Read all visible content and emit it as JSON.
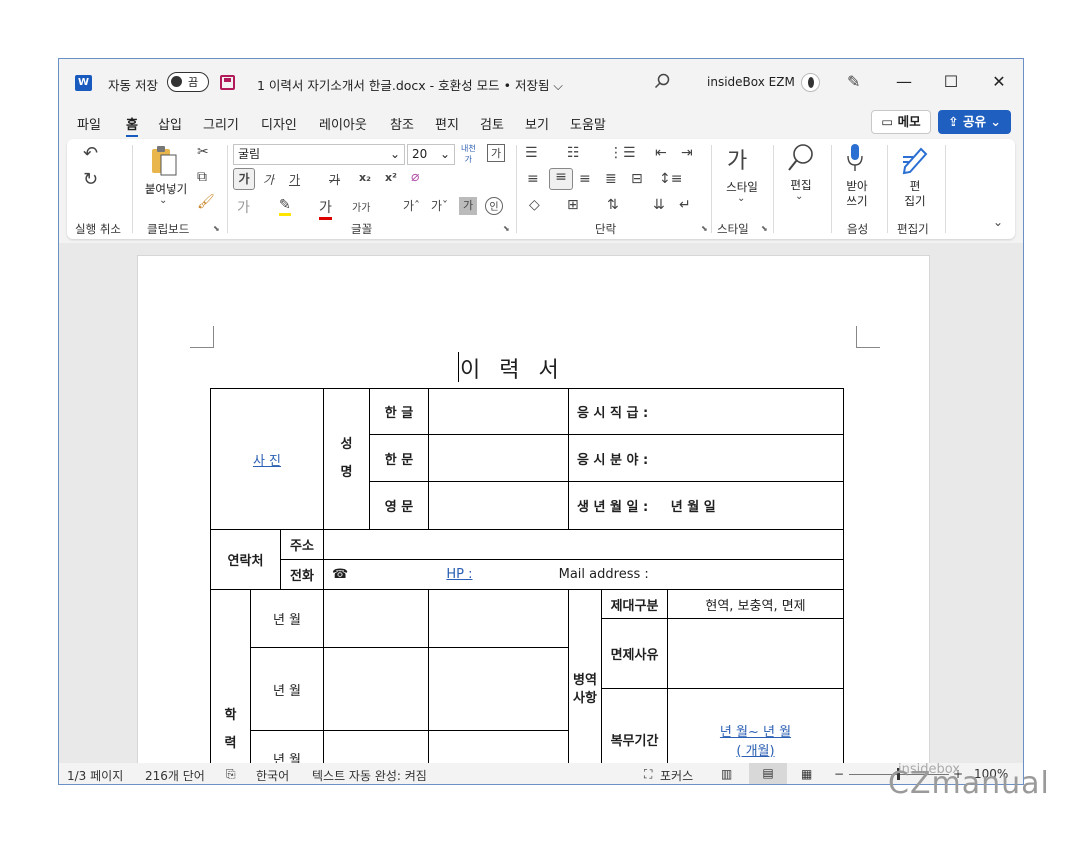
{
  "titlebar": {
    "app_icon": "W",
    "autosave_label": "자동 저장",
    "toggle_label": "끔",
    "document_title": "1 이력서   자기소개서 한글.docx  -  호환성 모드 • 저장됨 ⌵",
    "account_name": "insideBox EZM",
    "minimize": "—",
    "maximize": "☐",
    "close": "✕"
  },
  "menu": {
    "items": [
      "파일",
      "홈",
      "삽입",
      "그리기",
      "디자인",
      "레이아웃",
      "참조",
      "편지",
      "검토",
      "보기",
      "도움말"
    ],
    "memo_label": "메모",
    "share_label": "공유"
  },
  "ribbon": {
    "groups": {
      "undo": "실행 취소",
      "clipboard": "클립보드",
      "font": "글꼴",
      "paragraph": "단락",
      "styles": "스타일",
      "voice": "음성",
      "editor": "편집기"
    },
    "paste_label": "붙여넣기",
    "font_name": "굴림",
    "font_size": "20",
    "styles_label": "스타일",
    "edit_label": "편집",
    "dictate_label": "받아\n쓰기",
    "dictate_line1": "받아",
    "dictate_line2": "쓰기",
    "editor_line1": "편",
    "editor_line2": "집기",
    "bold_btn": "가",
    "italic_btn": "가",
    "underline_btn": "가",
    "strike_btn": "가",
    "sub_btn": "x₂",
    "sup_btn": "x²",
    "grow_btn": "가ˆ",
    "shrink_btn": "가ˇ",
    "case_btn": "가가",
    "highlight_btn": "가"
  },
  "document": {
    "title": "이   력   서",
    "photo_label": "사 진",
    "name_label": "성\n\n명",
    "name_label_1": "성",
    "name_label_2": "명",
    "hangul_label": "한 글",
    "hanja_label": "한 문",
    "english_label": "영 문",
    "position_label": "응 시 직 급 :",
    "field_label": "응 시 분 야 :",
    "birth_label": "생 년 월 일 :",
    "birth_format": "년    월    일",
    "contact_label": "연락처",
    "address_label": "주소",
    "phone_label": "전화",
    "phone_icon": "☎",
    "hp_label": "HP :",
    "mail_label": "Mail address :",
    "edu_label_1": "학",
    "edu_label_2": "력",
    "edu_rows": [
      "년   월",
      "년   월",
      "년   월"
    ],
    "military_label": "병역\n사항",
    "military_label_1": "병역",
    "military_label_2": "사항",
    "discharge_type_label": "제대구분",
    "discharge_type_value": "현역, 보충역, 면제",
    "exempt_reason_label": "면제사유",
    "service_period_label": "복무기간",
    "service_period_value_1": "년  월~   년  월",
    "service_period_value_2": "(  개월)"
  },
  "statusbar": {
    "page": "1/3 페이지",
    "words": "216개 단어",
    "language": "한국어",
    "autocomplete": "텍스트 자동 완성: 켜짐",
    "focus": "포커스",
    "zoom": "100%"
  },
  "watermark": {
    "line1": "insidebox",
    "line2": "CZmanual"
  },
  "colors": {
    "accent": "#185abd",
    "share_bg": "#1f5fbf",
    "link_underline": "#2b5fb3"
  }
}
